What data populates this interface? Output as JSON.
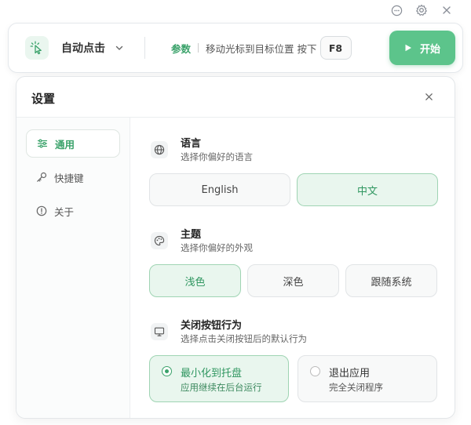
{
  "window_controls": {
    "chat_icon": "chat-bubble-icon",
    "settings_icon": "gear-icon",
    "close_icon": "close-icon"
  },
  "toolbar": {
    "mode_icon": "cursor-click-icon",
    "mode_label": "自动点击",
    "param_label": "参数",
    "hint": "移动光标到目标位置 按下",
    "hotkey": "F8",
    "start_label": "开始"
  },
  "settings": {
    "title": "设置",
    "nav": [
      {
        "label": "通用",
        "icon": "sliders-icon",
        "active": true
      },
      {
        "label": "快捷键",
        "icon": "key-icon",
        "active": false
      },
      {
        "label": "关于",
        "icon": "info-icon",
        "active": false
      }
    ],
    "language": {
      "title": "语言",
      "desc": "选择你偏好的语言",
      "options": [
        "English",
        "中文"
      ],
      "selected": "中文"
    },
    "theme": {
      "title": "主题",
      "desc": "选择你偏好的外观",
      "options": [
        "浅色",
        "深色",
        "跟随系统"
      ],
      "selected": "浅色"
    },
    "close_behavior": {
      "title": "关闭按钮行为",
      "desc": "选择点击关闭按钮后的默认行为",
      "options": [
        {
          "title": "最小化到托盘",
          "desc": "应用继续在后台运行"
        },
        {
          "title": "退出应用",
          "desc": "完全关闭程序"
        }
      ],
      "selected": "最小化到托盘"
    }
  },
  "colors": {
    "accent": "#3aa26a",
    "start_button": "#5cc48b",
    "selected_bg": "#e9f6ee"
  }
}
